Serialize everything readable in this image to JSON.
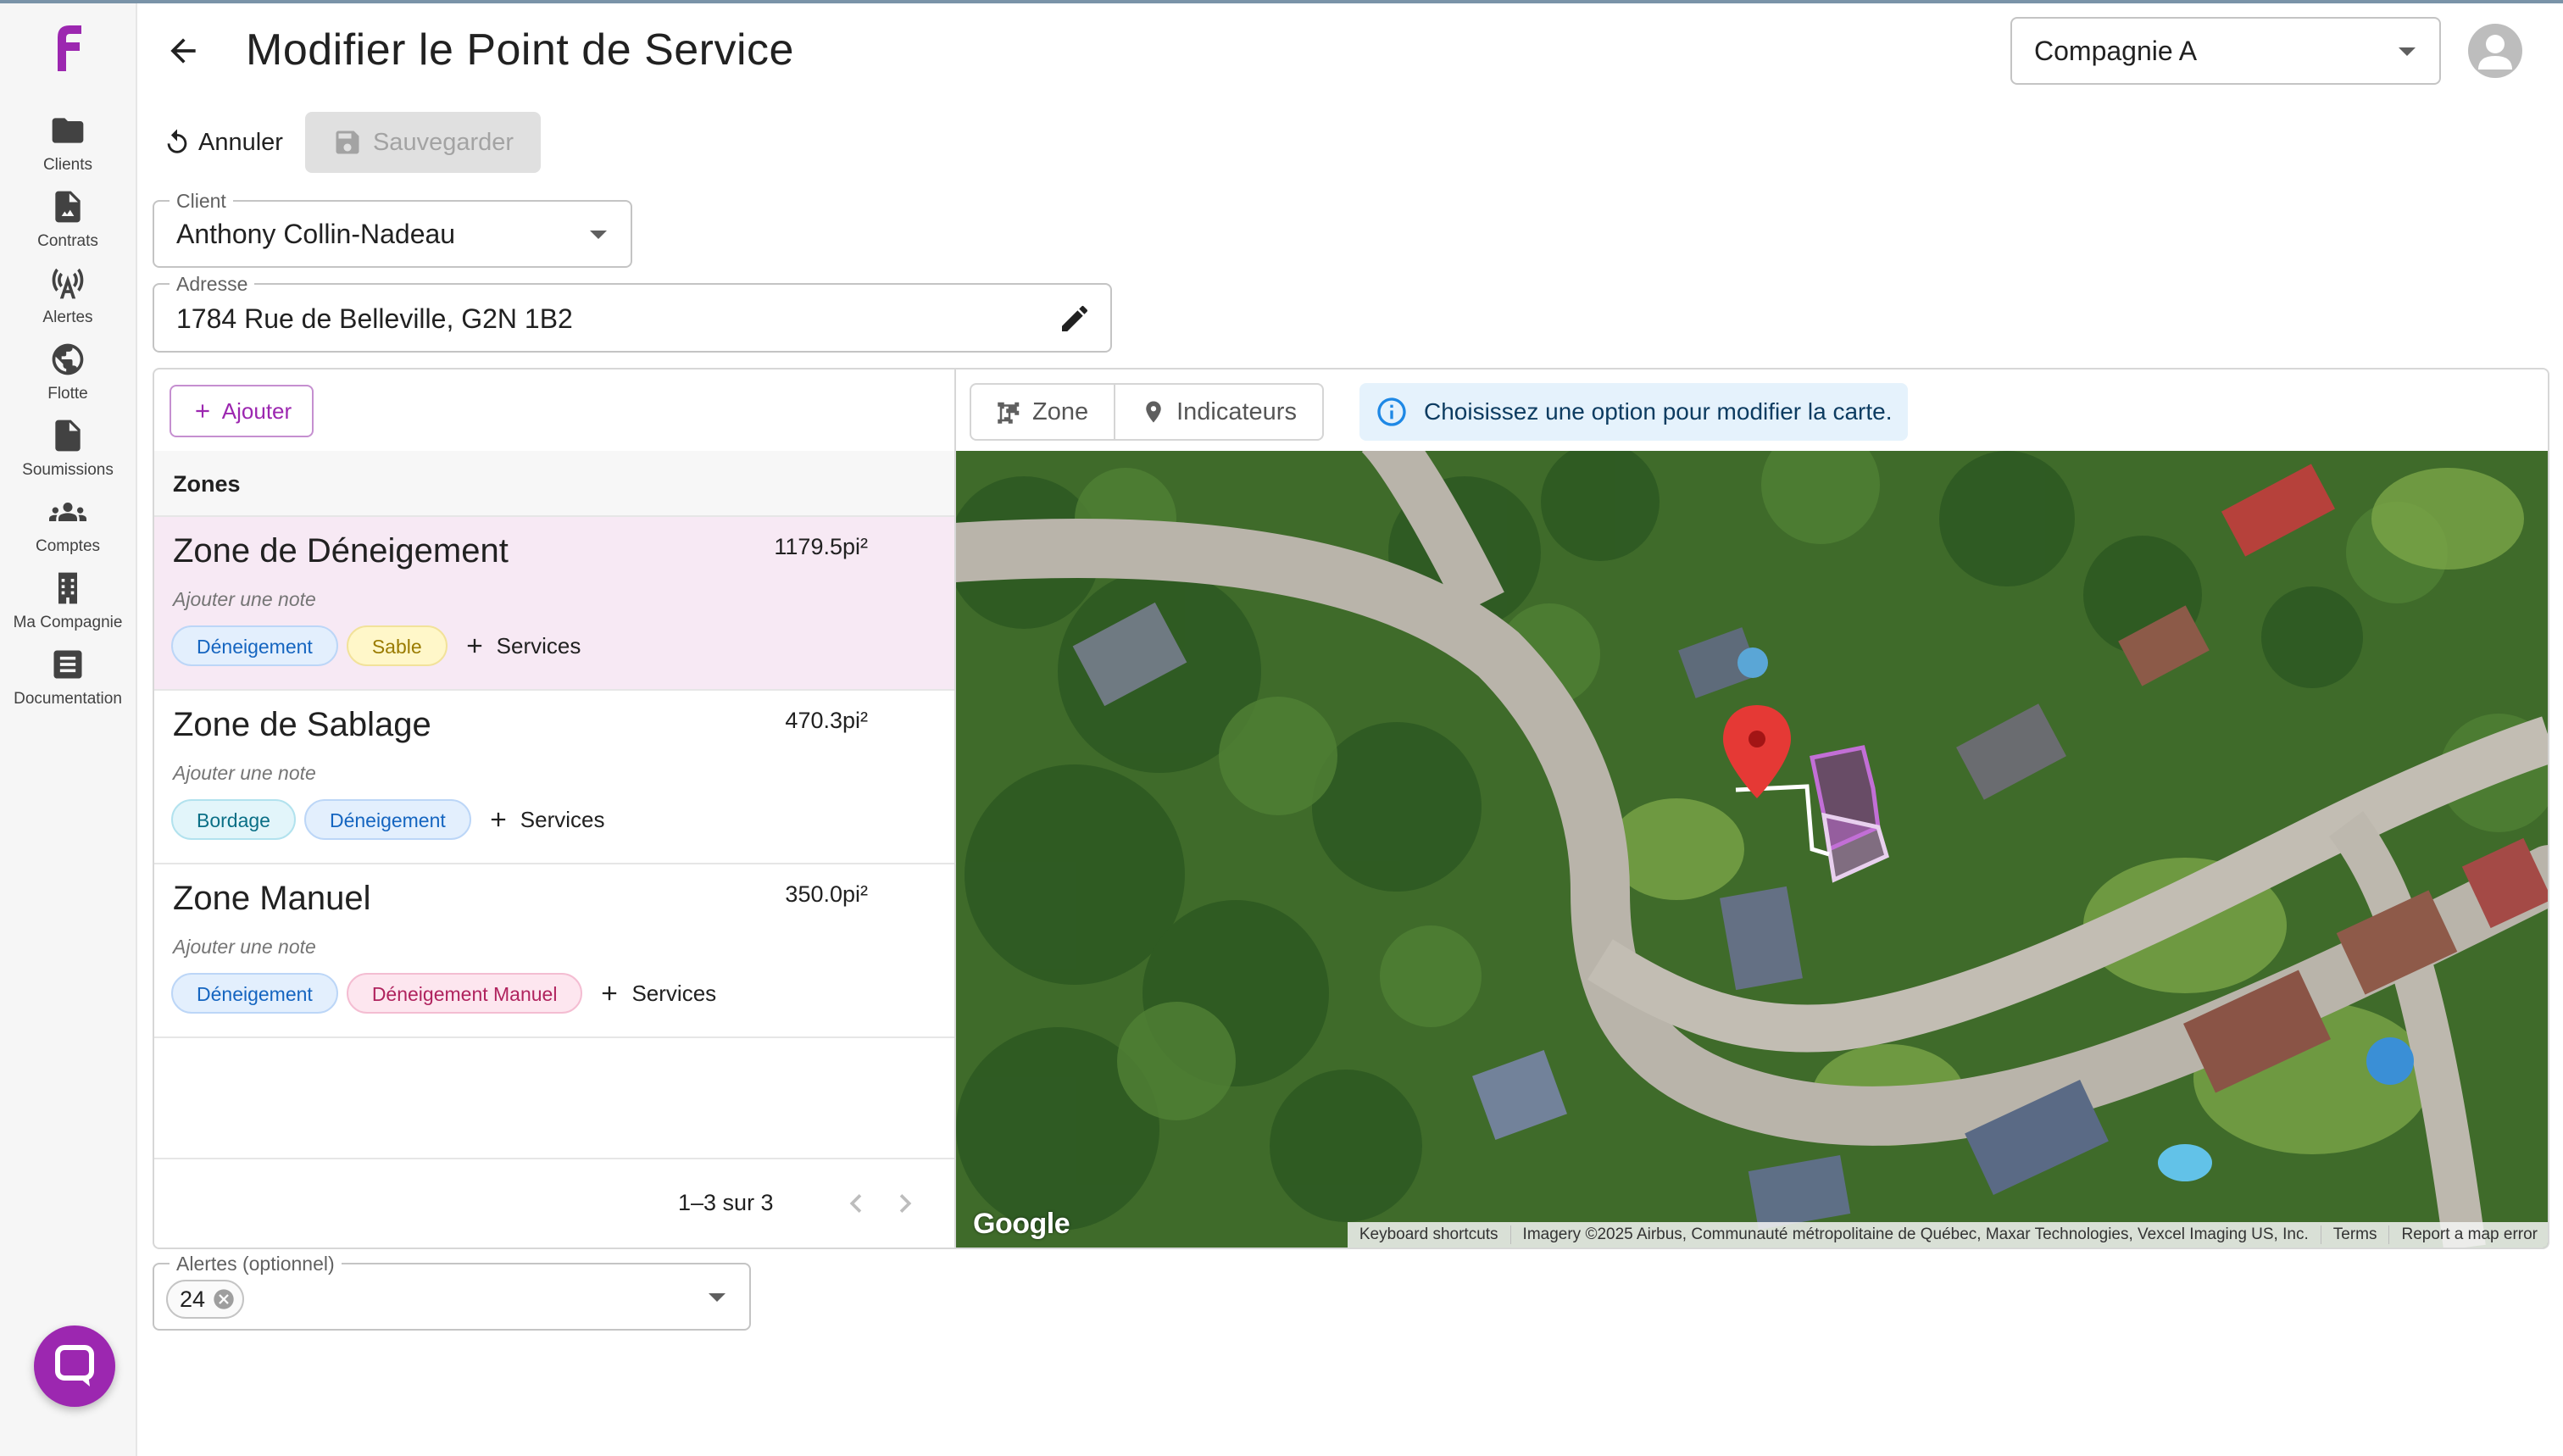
{
  "app": {
    "logo_letter": "F",
    "brand_color": "#9c27b0"
  },
  "header": {
    "title": "Modifier le Point de Service",
    "company": "Compagnie A"
  },
  "nav": {
    "items": [
      {
        "label": "Clients",
        "icon": "folder-icon"
      },
      {
        "label": "Contrats",
        "icon": "contract-icon"
      },
      {
        "label": "Alertes",
        "icon": "antenna-icon"
      },
      {
        "label": "Flotte",
        "icon": "globe-icon"
      },
      {
        "label": "Soumissions",
        "icon": "document-icon"
      },
      {
        "label": "Comptes",
        "icon": "people-icon"
      },
      {
        "label": "Ma Compagnie",
        "icon": "building-icon"
      },
      {
        "label": "Documentation",
        "icon": "article-icon"
      }
    ]
  },
  "actions": {
    "cancel": "Annuler",
    "save": "Sauvegarder"
  },
  "form": {
    "client_label": "Client",
    "client_value": "Anthony Collin-Nadeau",
    "address_label": "Adresse",
    "address_value": "1784 Rue de Belleville, G2N 1B2",
    "alerts_label": "Alertes (optionnel)",
    "alerts_value": "24"
  },
  "zones": {
    "add_label": "Ajouter",
    "header": "Zones",
    "services_label": "Services",
    "items": [
      {
        "name": "Zone de Déneigement",
        "area": "1179.5pi²",
        "note": "Ajouter une note",
        "chips": [
          {
            "label": "Déneigement",
            "color": "blue"
          },
          {
            "label": "Sable",
            "color": "yellow"
          }
        ],
        "selected": true
      },
      {
        "name": "Zone de Sablage",
        "area": "470.3pi²",
        "note": "Ajouter une note",
        "chips": [
          {
            "label": "Bordage",
            "color": "cyan"
          },
          {
            "label": "Déneigement",
            "color": "blue"
          }
        ],
        "selected": false
      },
      {
        "name": "Zone Manuel",
        "area": "350.0pi²",
        "note": "Ajouter une note",
        "chips": [
          {
            "label": "Déneigement",
            "color": "blue"
          },
          {
            "label": "Déneigement Manuel",
            "color": "pink"
          }
        ],
        "selected": false
      }
    ],
    "pagination": "1–3 sur 3"
  },
  "map": {
    "tool_zone": "Zone",
    "tool_markers": "Indicateurs",
    "info": "Choisissez une option pour modifier la carte.",
    "google": "Google",
    "attribution": [
      "Keyboard shortcuts",
      "Imagery ©2025 Airbus, Communauté métropolitaine de Québec, Maxar Technologies, Vexcel Imaging US, Inc.",
      "Terms",
      "Report a map error"
    ],
    "zone_color": "#9c27b0",
    "marker_color": "#e53935"
  }
}
